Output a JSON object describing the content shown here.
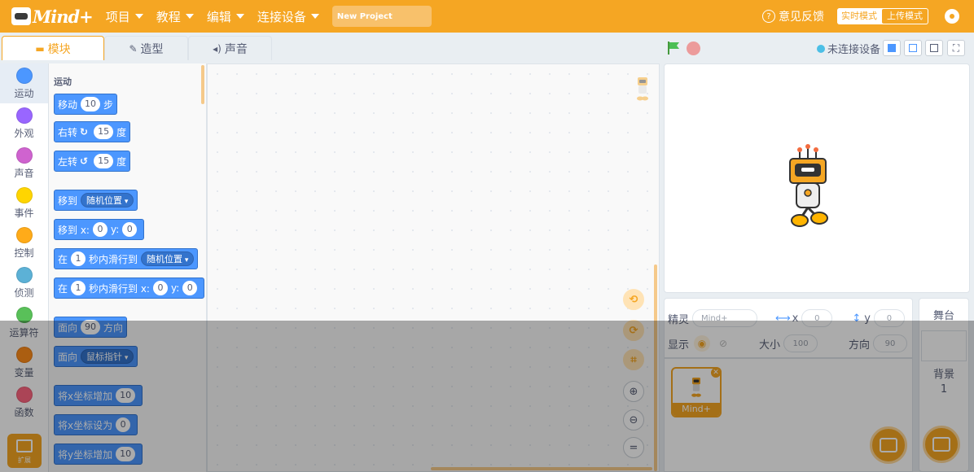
{
  "menubar": {
    "logo_text": "Mind+",
    "menus": [
      "项目",
      "教程",
      "编辑",
      "连接设备"
    ],
    "project_name": "New Project",
    "feedback": "意见反馈",
    "mode_realtime": "实时模式",
    "mode_upload": "上传模式"
  },
  "tabs": [
    {
      "label": "模块",
      "icon": "blocks-icon"
    },
    {
      "label": "造型",
      "icon": "brush-icon"
    },
    {
      "label": "声音",
      "icon": "speaker-icon"
    }
  ],
  "categories": [
    {
      "label": "运动",
      "color": "#4c97ff"
    },
    {
      "label": "外观",
      "color": "#9966ff"
    },
    {
      "label": "声音",
      "color": "#cf63cf"
    },
    {
      "label": "事件",
      "color": "#ffd500"
    },
    {
      "label": "控制",
      "color": "#ffab19"
    },
    {
      "label": "侦测",
      "color": "#5cb1d6"
    },
    {
      "label": "运算符",
      "color": "#59c059"
    },
    {
      "label": "变量",
      "color": "#ff8c1a"
    },
    {
      "label": "函数",
      "color": "#ff6680"
    }
  ],
  "extension_label": "扩展",
  "palette": {
    "title": "运动",
    "blocks": {
      "move": {
        "t1": "移动",
        "v1": "10",
        "t2": "步"
      },
      "turn_right": {
        "t1": "右转",
        "arrow": "↻",
        "v1": "15",
        "t2": "度"
      },
      "turn_left": {
        "t1": "左转",
        "arrow": "↺",
        "v1": "15",
        "t2": "度"
      },
      "goto": {
        "t1": "移到",
        "dd": "随机位置"
      },
      "goto_xy": {
        "t1": "移到 x:",
        "v1": "0",
        "t2": "y:",
        "v2": "0"
      },
      "glide": {
        "t1": "在",
        "v1": "1",
        "t2": "秒内滑行到",
        "dd": "随机位置"
      },
      "glide_xy": {
        "t1": "在",
        "v1": "1",
        "t2": "秒内滑行到 x:",
        "v2": "0",
        "t3": "y:",
        "v3": "0"
      },
      "point_dir": {
        "t1": "面向",
        "v1": "90",
        "t2": "方向"
      },
      "point_towards": {
        "t1": "面向",
        "dd": "鼠标指针"
      },
      "change_x": {
        "t1": "将x坐标增加",
        "v1": "10"
      },
      "set_x": {
        "t1": "将x坐标设为",
        "v1": "0"
      },
      "change_y": {
        "t1": "将y坐标增加",
        "v1": "10"
      }
    }
  },
  "stage_header": {
    "connection_status": "未连接设备",
    "accent": "#4c97ff"
  },
  "sprite_info": {
    "sprite_label": "精灵",
    "sprite_name": "Mind+",
    "x_label": "x",
    "x_value": "0",
    "y_label": "y",
    "y_value": "0",
    "show_label": "显示",
    "size_label": "大小",
    "size_value": "100",
    "direction_label": "方向",
    "direction_value": "90"
  },
  "sprites": [
    {
      "name": "Mind+"
    }
  ],
  "stage_panel": {
    "title": "舞台",
    "backdrop_label": "背景",
    "backdrop_count": "1"
  },
  "colors": {
    "brand": "#f5a623",
    "motion": "#4c97ff"
  }
}
